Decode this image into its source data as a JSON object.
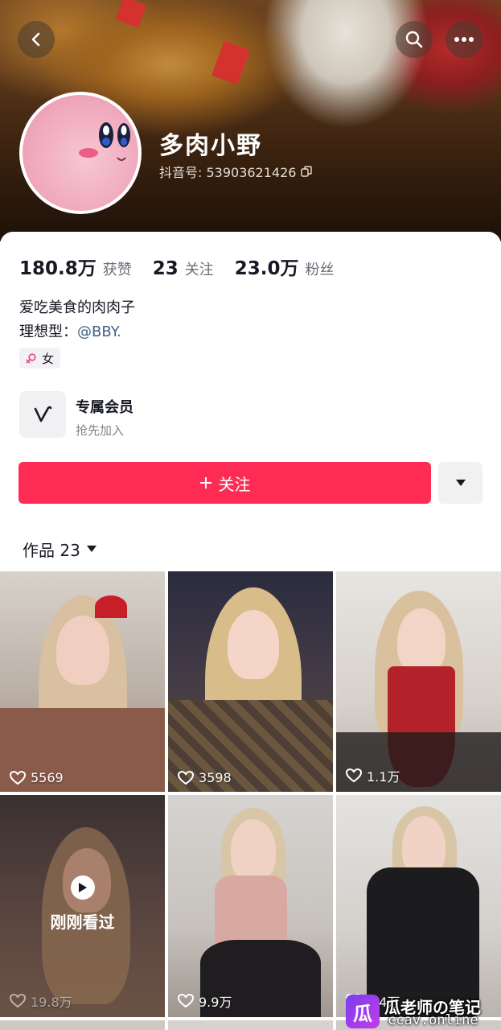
{
  "profile": {
    "name": "多肉小野",
    "douyin_id_label": "抖音号: 53903621426"
  },
  "stats": [
    {
      "value": "180.8万",
      "label": "获赞"
    },
    {
      "value": "23",
      "label": "关注"
    },
    {
      "value": "23.0万",
      "label": "粉丝"
    }
  ],
  "bio": {
    "line1": "爱吃美食的肉肉子",
    "line2_prefix": "理想型：",
    "line2_mention": "@BBY."
  },
  "gender": "女",
  "membership": {
    "title": "专属会员",
    "subtitle": "抢先加入"
  },
  "actions": {
    "follow_label": "关注"
  },
  "works": {
    "label": "作品 23"
  },
  "videos": [
    {
      "likes": "5569"
    },
    {
      "likes": "3598"
    },
    {
      "likes": "1.1万"
    },
    {
      "likes": "19.8万",
      "overlay": "刚刚看过"
    },
    {
      "likes": "9.9万"
    },
    {
      "likes": "4.4万"
    }
  ],
  "watermark": {
    "logo_char": "瓜",
    "line1": "瓜老师の笔记",
    "line2": "ccav.online"
  },
  "colors": {
    "accent": "#fe2c55",
    "mention": "#3d5f8a"
  }
}
